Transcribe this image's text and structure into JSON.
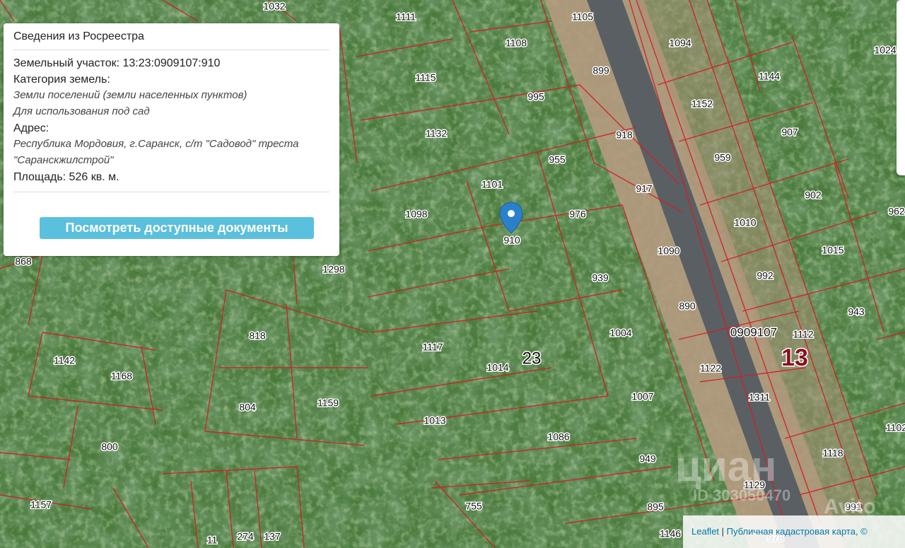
{
  "popup": {
    "title": "Сведения из Росреестра",
    "parcel_label": "Земельный участок:",
    "parcel_value": "13:23:0909107:910",
    "category_label": "Категория земель:",
    "category_value": "Земли поселений (земли населенных пунктов)",
    "usage_value": "Для использования под сад",
    "address_label": "Адрес:",
    "address_line1": "Республика Мордовия, г.Саранск, с/т \"Садовод\" треста",
    "address_line2": "\"Саранскжилстрой\"",
    "area_label": "Площадь:",
    "area_value": "526 кв. м.",
    "button_label": "Посмотреть доступные документы"
  },
  "map": {
    "marker_parcel": "910",
    "quarter_label": "0909107",
    "region_label": "13",
    "district_label": "23",
    "parcels": [
      "1111",
      "1105",
      "1094",
      "1108",
      "1115",
      "899",
      "995",
      "1144",
      "1152",
      "907",
      "1132",
      "918",
      "955",
      "959",
      "1101",
      "917",
      "902",
      "1098",
      "976",
      "910",
      "962",
      "1010",
      "1015",
      "1090",
      "939",
      "992",
      "868",
      "1298",
      "890",
      "943",
      "818",
      "1004",
      "1112",
      "1142",
      "1168",
      "1117",
      "1014",
      "1122",
      "804",
      "1159",
      "1007",
      "1311",
      "1013",
      "800",
      "1086",
      "1102",
      "949",
      "1118",
      "1157",
      "1129",
      "755",
      "895",
      "991",
      "1146",
      "978",
      "1024",
      "1032",
      "274",
      "137",
      "11"
    ]
  },
  "attribution": {
    "leaflet": "Leaflet",
    "separator": " | ",
    "source": "Публичная кадастровая карта, ©"
  },
  "watermarks": {
    "cian": "циан",
    "cian_id": "ID 303050470",
    "avito": "Avito"
  },
  "colors": {
    "boundary": "#d21e26",
    "button": "#5bc0de",
    "marker": "#2a81cb"
  }
}
